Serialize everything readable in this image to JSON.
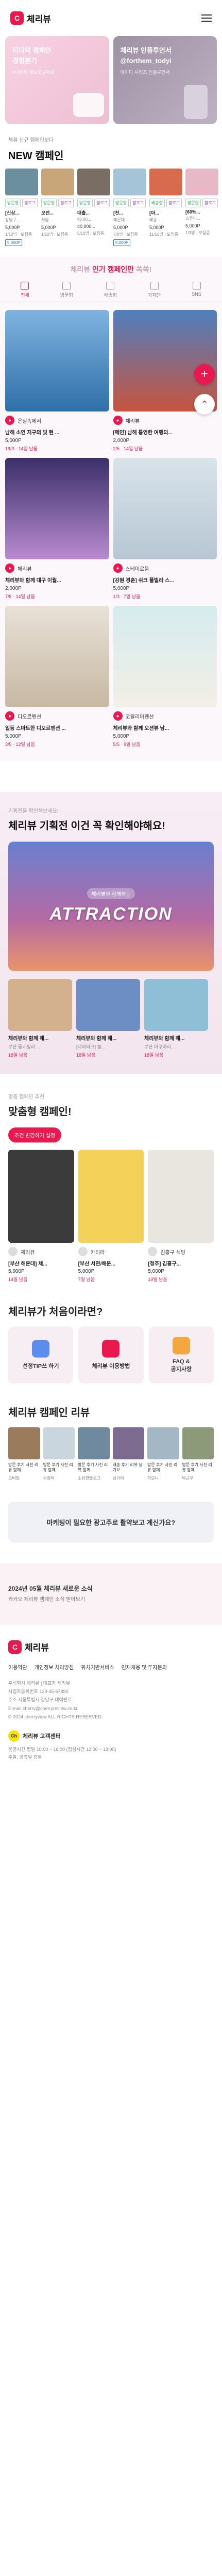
{
  "header": {
    "logo_mark": "C",
    "logo_text": "체리뷰"
  },
  "hero": [
    {
      "title": "티디의 캠페인\n경험분기",
      "sub": "#이벤트 해보고싶어요"
    },
    {
      "title": "체리뷰 인플루언서\n@forthem_todyi",
      "sub": "아이디 시리즈 인플루언서"
    }
  ],
  "new_campaigns": {
    "caption": "체류 신규 캠페인보다",
    "title": "NEW 캠페인",
    "items": [
      {
        "chips": [
          "방문형",
          "블로그"
        ],
        "name": "[신상...",
        "desc": "강남구 ...",
        "price": "5,000P",
        "meta": "1/10명 · 모집중",
        "pill": "5,000P"
      },
      {
        "chips": [
          "방문형",
          "블로그"
        ],
        "name": "오전...",
        "desc": "서울 ...",
        "price": "5,000P",
        "meta": "1/10명 · 모집중",
        "pill": ""
      },
      {
        "chips": [
          "방문형",
          "블로그"
        ],
        "name": "대출...",
        "desc": "40,00...",
        "price": "40,000...",
        "meta": "5/10명 · 모집중",
        "pill": ""
      },
      {
        "chips": [
          "방문형",
          "블로그"
        ],
        "name": "[천...",
        "desc": "해운대 ...",
        "price": "5,000P",
        "meta": "7/8명 · 모집중",
        "pill": "5,000P"
      },
      {
        "chips": [
          "배송형",
          "블로그"
        ],
        "name": "[아...",
        "desc": "배송 ...",
        "price": "5,000P",
        "meta": "11/15명 · 모집중",
        "pill": ""
      },
      {
        "chips": [
          "방문형",
          "블로그"
        ],
        "name": "[60%...",
        "desc": "스튜디...",
        "price": "5,000P",
        "meta": "1/3명 · 모집중",
        "pill": ""
      }
    ]
  },
  "popular": {
    "head_prefix": "체리뷰 ",
    "head_strong": "인기 캠페인만",
    "head_suffix": " 쏙쏙!",
    "tabs": [
      "전체",
      "방문형",
      "배송형",
      "기자단",
      "SNS"
    ],
    "items": [
      {
        "brand": "온실속에서",
        "title": "남해 소연 지구의 빛 현 ...",
        "price": "5,000P",
        "meta_a": "19/3",
        "meta_b": "14일 남음"
      },
      {
        "brand": "체리뷰",
        "title": "[메인] 남해 통영한 여행의...",
        "price": "2,000P",
        "meta_a": "2/5",
        "meta_b": "14일 남음"
      },
      {
        "brand": "체리뷰",
        "title": "체리뷰와 함께 대구 이월...",
        "price": "2,000P",
        "meta_a": "7/8",
        "meta_b": "14일 남음"
      },
      {
        "brand": "스테이로움",
        "title": "[강원 경춘] 쉬크 풀빌라 스...",
        "price": "5,000P",
        "meta_a": "1/3",
        "meta_b": "7일 남음"
      },
      {
        "brand": "디오르펜션",
        "title": "일등 스마트한 디오르펜션 ...",
        "price": "5,000P",
        "meta_a": "3/5",
        "meta_b": "12일 남음"
      },
      {
        "brand": "코랄리아펜션",
        "title": "체리뷰와 함께 오션뷰 남...",
        "price": "5,000P",
        "meta_a": "5/5",
        "meta_b": "9일 남음"
      }
    ]
  },
  "attraction": {
    "caption": "기획전을 확인해보세요!",
    "title": "체리뷰 기획전 이건 꼭 확인해야해요!",
    "banner_small": "체리뷰와 함께하는",
    "banner_big": "ATTRACTION",
    "cards": [
      {
        "title": "체리뷰와 함께 해...",
        "desc": "부산 동래필라...",
        "meta": "18일 남음"
      },
      {
        "title": "체리뷰와 함께 해...",
        "desc": "[테마파크] 놀...",
        "meta": "18일 남음"
      },
      {
        "title": "체리뷰와 함께 해...",
        "desc": "부산 아쿠아리...",
        "meta": "18일 남음"
      }
    ]
  },
  "custom": {
    "caption": "맞춤 캠페인 추천",
    "title": "맞춤형 캠페인!",
    "button": "조건 변경하기 설정",
    "cards": [
      {
        "brand": "체리뷰",
        "title": "[부산 해운대] 체...",
        "price": "5,000P",
        "meta": "14일 남음"
      },
      {
        "brand": "카티라",
        "title": "[부산 서면/해운...",
        "price": "5,000P",
        "meta": "7일 남음"
      },
      {
        "brand": "김홍구 식당",
        "title": "[청주] 김홍구...",
        "price": "5,000P",
        "meta": "10일 남음"
      }
    ]
  },
  "first": {
    "title": "체리뷰가 처음이라면?",
    "cards": [
      "선정TIP쓰 하기",
      "체리뷰 이용방법",
      "FAQ &\n공지사항"
    ]
  },
  "reviews": {
    "title": "체리뷰 캠페인 리뷰",
    "items": [
      {
        "text": "방문 후기 사진 리뷰 함께",
        "name": "오버밈"
      },
      {
        "text": "방문 후기 사진 리뷰 함께",
        "name": "수정덕"
      },
      {
        "text": "방문 후기 사진 리뷰 함께",
        "name": "소유한블로그"
      },
      {
        "text": "배송 후기 리뷰 남겨요",
        "name": "남기리"
      },
      {
        "text": "방문 후기 사진 리뷰 함께",
        "name": "하모니"
      },
      {
        "text": "방문 후기 사진 리뷰 함께",
        "name": "박근우"
      }
    ]
  },
  "ad": {
    "text": "마케팅이 필요한 광고주로 활약보고 계신가요?"
  },
  "notice": {
    "line1": "2024년 05월 체리뷰 새로운 소식",
    "line2": "카카오 체리뷰 캠페인 소식 받아보기"
  },
  "footer": {
    "logo_text": "체리뷰",
    "links": [
      "이용약관",
      "개인정보 처리방침",
      "위치기반서비스",
      "인재채용 및 투자문의"
    ],
    "info": "주식회사 체리뷰 | 대표자 체리뷰\n사업자등록번호 123-45-67890\n주소 서울특별시 강남구 테헤란로\nE-mail cherry@cherryreview.co.kr\n© 2024 cherryview ALL RIGHTS RESERVED",
    "cs_dot": "Ch",
    "cs": "체리뷰 고객센터",
    "hours": "운영시간 평일 10:00 ~ 18:00 (점심시간 12:00 ~ 13:00)\n주말, 공휴일 휴무"
  },
  "colors": {
    "accent": "#e8194f"
  }
}
